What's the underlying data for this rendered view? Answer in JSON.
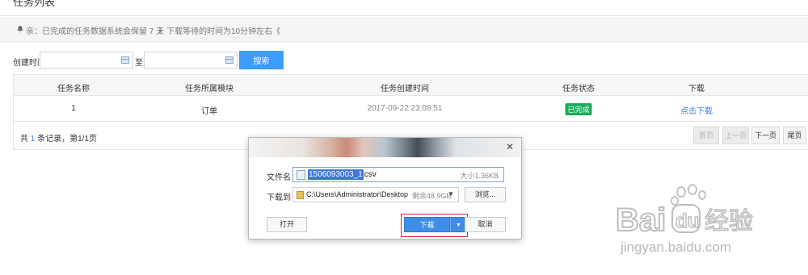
{
  "page": {
    "title": "任务列表"
  },
  "notice": {
    "line1": "亲：已完成的任务数据系统会保留 7 天",
    "line2": "》下载等待的时间为10分钟左右《"
  },
  "filter": {
    "created_label": "创建时间",
    "to_label": "至",
    "start_value": "",
    "end_value": "",
    "search_label": "搜索"
  },
  "table": {
    "headers": [
      "任务名称",
      "任务所属模块",
      "任务创建时间",
      "任务状态",
      "下载"
    ],
    "rows": [
      {
        "name": "1",
        "module": "订单",
        "created": "2017-09-22 23:08:51",
        "status": "已完成",
        "download": "点击下载"
      }
    ],
    "footer_prefix": "共 ",
    "footer_count": "1",
    "footer_suffix": " 条记录，第1/1页"
  },
  "pagination": {
    "first": "首页",
    "prev": "上一页",
    "next": "下一页",
    "last": "尾页"
  },
  "dialog": {
    "filename_label": "文件名",
    "filename_selected": "1506093003_1",
    "filename_ext": ".csv",
    "size_text": "大小1.36KB",
    "saveto_label": "下载到",
    "path": "C:\\Users\\Administrator\\Desktop",
    "free_space": "剩余48.9GB",
    "browse_label": "浏览...",
    "open_label": "打开",
    "download_label": "下载",
    "cancel_label": "取消"
  },
  "watermark": {
    "brand": "Baidu经验",
    "url": "jingyan.baidu.com"
  },
  "colors": {
    "accent": "#3c9cff",
    "success": "#1aab5c",
    "link": "#3a7de0",
    "highlight": "#e02020"
  }
}
